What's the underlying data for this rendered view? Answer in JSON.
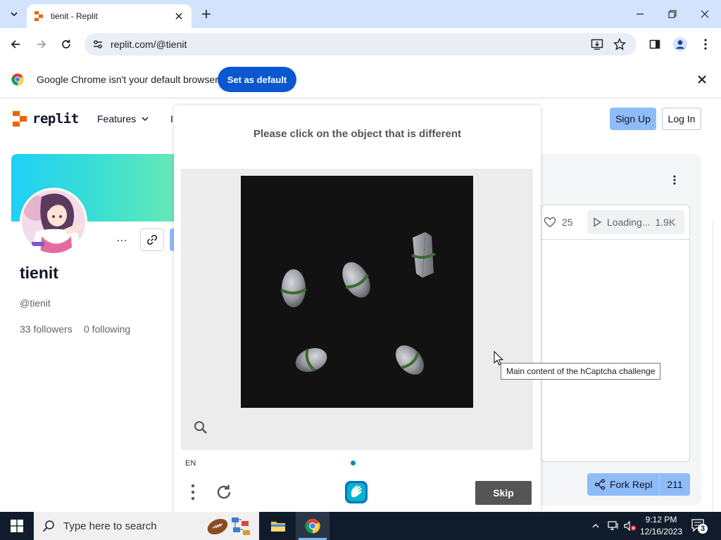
{
  "browser": {
    "tab_title": "tienit - Replit",
    "url": "replit.com/@tienit"
  },
  "infobar": {
    "message": "Google Chrome isn't your default browser",
    "button_label": "Set as default"
  },
  "replit": {
    "logo_text": "replit",
    "nav_features": "Features",
    "nav_partial": "I",
    "sign_up": "Sign Up",
    "log_in": "Log In",
    "profile": {
      "display_name": "tienit",
      "handle": "@tienit",
      "followers": "33 followers",
      "following": "0 following",
      "more": "…"
    },
    "repl_card": {
      "likes": "25",
      "runs_label": "Loading...",
      "runs_count": "1.9K",
      "fork_label": "Fork Repl",
      "fork_count": "211"
    }
  },
  "captcha": {
    "prompt": "Please click on the object that is different",
    "language": "EN",
    "skip": "Skip",
    "tooltip": "Main content of the hCaptcha challenge"
  },
  "taskbar": {
    "search_placeholder": "Type here to search",
    "time": "9:12 PM",
    "date": "12/16/2023",
    "notification_count": "3"
  },
  "colors": {
    "chrome_tabstrip": "#d3e3fd",
    "chrome_blue": "#0b57d0",
    "replit_orange": "#f26207",
    "replit_button_blue": "#8ebcf9",
    "captcha_skip": "#555555",
    "taskbar": "#101c2c"
  }
}
